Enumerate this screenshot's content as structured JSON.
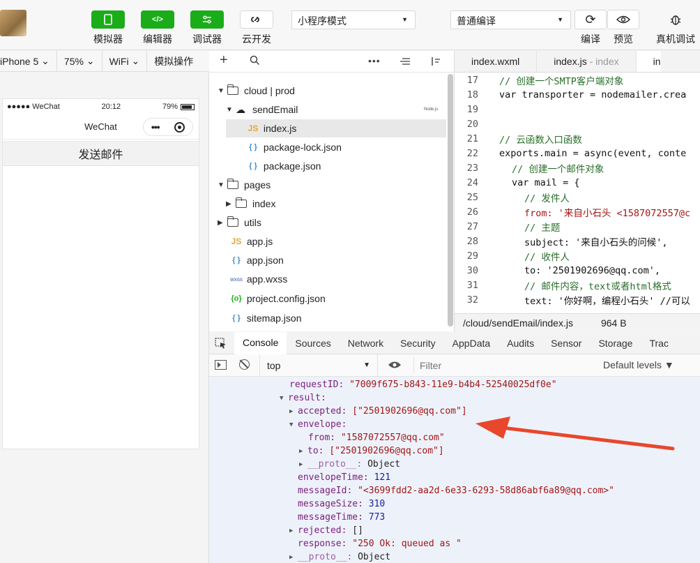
{
  "toolbar": {
    "simulator_label": "模拟器",
    "editor_label": "编辑器",
    "debugger_label": "调试器",
    "cloud_label": "云开发",
    "mode_select": "小程序模式",
    "compile_select": "普通编译",
    "compile_label": "编译",
    "preview_label": "预览",
    "realdevice_label": "真机调试"
  },
  "subbar": {
    "device": "iPhone 5",
    "zoom": "75%",
    "network": "WiFi",
    "ops": "模拟操作"
  },
  "phone": {
    "carrier": "●●●●● WeChat",
    "time": "20:12",
    "battery": "79%",
    "nav_title": "WeChat",
    "send_button": "发送邮件"
  },
  "filetree": [
    {
      "label": "cloud | prod",
      "type": "folder-cloud"
    },
    {
      "label": "sendEmail",
      "type": "cloud-function",
      "badge": "Node.js"
    },
    {
      "label": "index.js",
      "type": "js",
      "selected": true
    },
    {
      "label": "package-lock.json",
      "type": "json"
    },
    {
      "label": "package.json",
      "type": "json"
    },
    {
      "label": "pages",
      "type": "folder-open"
    },
    {
      "label": "index",
      "type": "folder"
    },
    {
      "label": "utils",
      "type": "folder"
    },
    {
      "label": "app.js",
      "type": "js"
    },
    {
      "label": "app.json",
      "type": "json"
    },
    {
      "label": "app.wxss",
      "type": "wxss"
    },
    {
      "label": "project.config.json",
      "type": "cfg"
    },
    {
      "label": "sitemap.json",
      "type": "json"
    }
  ],
  "editor": {
    "tabs": [
      "index.wxml",
      "index.js",
      "- index",
      "in"
    ],
    "status_path": "/cloud/sendEmail/index.js",
    "status_size": "964 B",
    "lines": [
      {
        "n": "17",
        "t": "// 创建一个SMTP客户端对象"
      },
      {
        "n": "18",
        "t": "var transporter = nodemailer.crea"
      },
      {
        "n": "19",
        "t": ""
      },
      {
        "n": "20",
        "t": ""
      },
      {
        "n": "21",
        "t": "// 云函数入口函数"
      },
      {
        "n": "22",
        "t": "exports.main = async(event, conte"
      },
      {
        "n": "23",
        "t": "// 创建一个邮件对象"
      },
      {
        "n": "24",
        "t": "var mail = {"
      },
      {
        "n": "25",
        "t": "// 发件人"
      },
      {
        "n": "26",
        "t": "from: '来自小石头 <1587072557@c"
      },
      {
        "n": "27",
        "t": "// 主题"
      },
      {
        "n": "28",
        "t": "subject: '来自小石头的问候',"
      },
      {
        "n": "29",
        "t": "// 收件人"
      },
      {
        "n": "30",
        "t": "to: '2501902696@qq.com',"
      },
      {
        "n": "31",
        "t": "// 邮件内容，text或者html格式"
      },
      {
        "n": "32",
        "t": "text: '你好啊，编程小石头' //可以"
      }
    ]
  },
  "devtools": {
    "tabs": [
      "Console",
      "Sources",
      "Network",
      "Security",
      "AppData",
      "Audits",
      "Sensor",
      "Storage",
      "Trac"
    ],
    "context": "top",
    "filter_placeholder": "Filter",
    "levels": "Default levels ▼",
    "console": {
      "requestID_key": "requestID:",
      "requestID_val": "\"7009f675-b843-11e9-b4b4-52540025df0e\"",
      "result_key": "result:",
      "accepted_key": "accepted:",
      "accepted_val": "[\"2501902696@qq.com\"]",
      "envelope_key": "envelope:",
      "from_key": "from:",
      "from_val": "\"1587072557@qq.com\"",
      "to_key": "to:",
      "to_val": "[\"2501902696@qq.com\"]",
      "proto1_key": "__proto__:",
      "proto1_val": "Object",
      "envelopeTime_key": "envelopeTime:",
      "envelopeTime_val": "121",
      "messageId_key": "messageId:",
      "messageId_val": "\"<3699fdd2-aa2d-6e33-6293-58d86abf6a89@qq.com>\"",
      "messageSize_key": "messageSize:",
      "messageSize_val": "310",
      "messageTime_key": "messageTime:",
      "messageTime_val": "773",
      "rejected_key": "rejected:",
      "rejected_val": "[]",
      "response_key": "response:",
      "response_val": "\"250 Ok: queued as \"",
      "proto2_key": "__proto__:",
      "proto2_val": "Object"
    }
  },
  "colors": {
    "accent": "#1aad19",
    "arrow": "#e8472b"
  }
}
